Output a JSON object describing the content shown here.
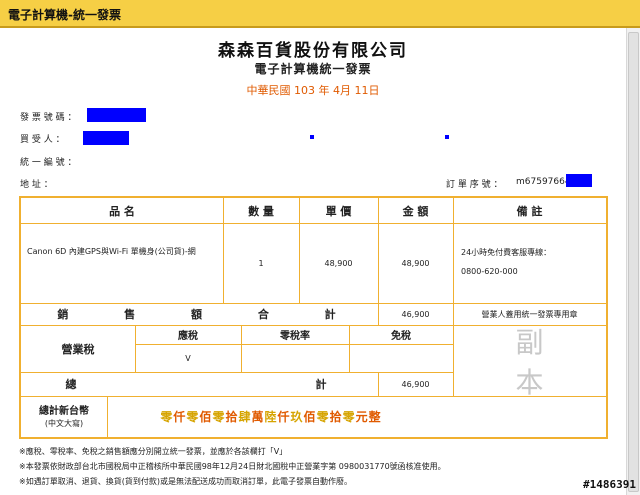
{
  "window": {
    "title": "電子計算機-統一發票"
  },
  "header": {
    "company": "森森百貨股份有限公司",
    "subtitle": "電子計算機統一發票",
    "date": "中華民國 103 年 4月 11日"
  },
  "fields": {
    "invoice_no_label": "發 票 號 碼 ：",
    "buyer_label": "買 受 人 ：",
    "tax_id_label": "統 一 編 號 ：",
    "address_label": "地 址 ：",
    "order_no_label": "訂 單 序 號 ：",
    "order_no_prefix": "m675976648"
  },
  "table": {
    "headers": {
      "item": "品 名",
      "qty": "數 量",
      "unit_price": "單 價",
      "amount": "金 額",
      "remark": "備 註"
    },
    "row": {
      "item": "Canon 6D 內建GPS與Wi-Fi 單機身(公司貨)-網",
      "qty": "1",
      "unit_price": "48,900",
      "amount": "48,900",
      "remark_line1": "24小時免付費客服專線：",
      "remark_line2": "0800-620-000"
    },
    "sales_total_label": "銷 售 額 合 計",
    "sales_total": "46,900",
    "stamp_note": "營業人蓋用統一發票專用章",
    "business_tax_label": "營業稅",
    "tax_headers": {
      "taxable": "應稅",
      "zero_rate": "零稅率",
      "exempt": "免稅"
    },
    "tax_mark": "V",
    "total_label_left": "總",
    "total_label_right": "計",
    "total": "46,900",
    "copy_mark": "副 本",
    "ntd_total_label": "總計新台幣",
    "ntd_total_sub": "(中文大寫)",
    "amount_words": [
      {
        "t": "零",
        "c": "#d6a400"
      },
      {
        "t": "仟",
        "c": "#e05a00"
      },
      {
        "t": "零",
        "c": "#d6a400"
      },
      {
        "t": "佰",
        "c": "#e05a00"
      },
      {
        "t": "零",
        "c": "#d6a400"
      },
      {
        "t": "拾",
        "c": "#e05a00"
      },
      {
        "t": "肆",
        "c": "#d6a400"
      },
      {
        "t": "萬",
        "c": "#e05a00"
      },
      {
        "t": "陸",
        "c": "#d6a400"
      },
      {
        "t": "仟",
        "c": "#e05a00"
      },
      {
        "t": "玖",
        "c": "#d6a400"
      },
      {
        "t": "佰",
        "c": "#e05a00"
      },
      {
        "t": "零",
        "c": "#d6a400"
      },
      {
        "t": "拾",
        "c": "#e05a00"
      },
      {
        "t": "零",
        "c": "#d6a400"
      },
      {
        "t": "元整",
        "c": "#e05a00"
      }
    ]
  },
  "notes": [
    "※應稅、零稅率、免稅之銷售額應分別開立統一發票，並應於各該欄打「V」",
    "※本發票依財政部台北市國稅局中正稽核所中華民國98年12月24日財北國稅中正營業字第 0980031770號函核准使用。",
    "※如遇訂單取消、退貨、換貨(貨到付款)或是無法配送成功而取消訂單，此電子發票自動作廢。"
  ],
  "watermark": "#1486391",
  "colors": {
    "titlebar": "#f6cf45",
    "border": "#f0b030",
    "date": "#e05a00",
    "redaction": "#0000ff"
  }
}
